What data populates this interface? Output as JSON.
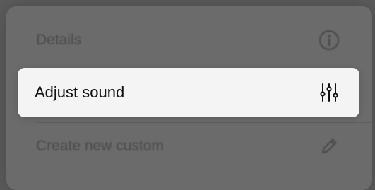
{
  "menu": {
    "items": [
      {
        "label": "Details",
        "icon": "info-circle-icon",
        "state": "dimmed"
      },
      {
        "label": "Adjust sound",
        "icon": "sliders-icon",
        "state": "highlighted"
      },
      {
        "label": "Create new custom",
        "icon": "pencil-icon",
        "state": "dimmed"
      }
    ]
  },
  "colors": {
    "backdrop": "#5d5d5d",
    "menu_panel": "#6b6b6b",
    "highlight_bg": "#f4f4f4",
    "highlight_text": "#111111",
    "dimmed_text": "#4a4a4a"
  }
}
